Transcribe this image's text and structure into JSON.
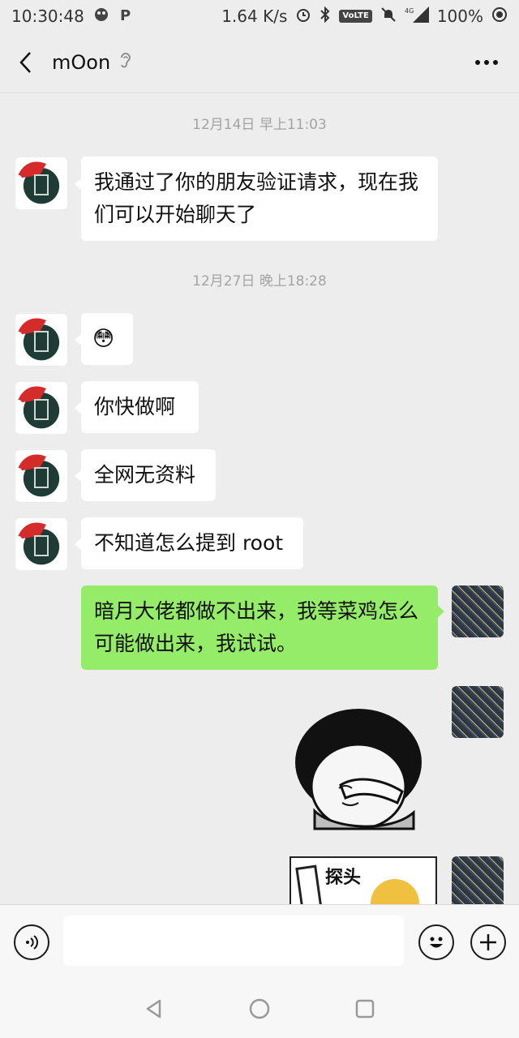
{
  "status_bar": {
    "time": "10:30:48",
    "speed": "1.64 K/s",
    "volte": "VoLTE",
    "network": "4G",
    "battery": "100%"
  },
  "header": {
    "title": "mOon"
  },
  "chat": {
    "timestamps": [
      "12月14日 早上11:03",
      "12月27日 晚上18:28"
    ],
    "messages": [
      {
        "side": "in",
        "text": "我通过了你的朋友验证请求，现在我们可以开始聊天了"
      },
      {
        "side": "in",
        "text": "😳"
      },
      {
        "side": "in",
        "text": " 你快做啊"
      },
      {
        "side": "in",
        "text": "全网无资料"
      },
      {
        "side": "in",
        "text": "不知道怎么提到 root"
      },
      {
        "side": "out",
        "text": "暗月大佬都做不出来，我等菜鸡怎么可能做出来，我试试。"
      }
    ],
    "sticker_text": "探头"
  },
  "input_bar": {
    "placeholder": ""
  },
  "colors": {
    "background": "#ededed",
    "incoming_bubble": "#ffffff",
    "outgoing_bubble": "#95ec69",
    "timestamp": "#a3a3a3"
  }
}
